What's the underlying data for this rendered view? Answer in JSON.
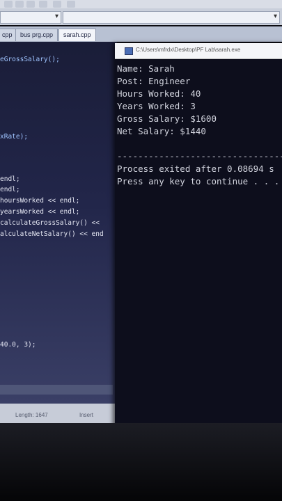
{
  "toolbar": {
    "buttons": [
      "button",
      "button",
      "button",
      "button",
      "button",
      "button"
    ]
  },
  "tabs": [
    {
      "label": "cpp",
      "active": false
    },
    {
      "label": "bus prg.cpp",
      "active": false
    },
    {
      "label": "sarah.cpp",
      "active": true
    }
  ],
  "editor": {
    "lines": [
      {
        "text": "eGrossSalary();"
      },
      {
        "text": "xRate);"
      },
      {
        "text": "endl;"
      },
      {
        "text": "endl;"
      },
      {
        "text": "hoursWorked << endl;"
      },
      {
        "text": "yearsWorked << endl;"
      },
      {
        "text": " calculateGrossSalary() <<"
      },
      {
        "text": "alculateNetSalary() << end"
      },
      {
        "text": "40.0, 3);"
      }
    ]
  },
  "statusbar": {
    "length": "Length: 1647",
    "mode": "Insert"
  },
  "console": {
    "title": "C:\\Users\\mfrdx\\Desktop\\PF Lab\\sarah.exe",
    "lines": [
      "Name: Sarah",
      "Post: Engineer",
      "Hours Worked: 40",
      "Years Worked: 3",
      "Gross Salary: $1600",
      "Net Salary: $1440",
      "",
      "--------------------------------",
      "Process exited after 0.08694 s",
      "Press any key to continue . . ."
    ]
  }
}
